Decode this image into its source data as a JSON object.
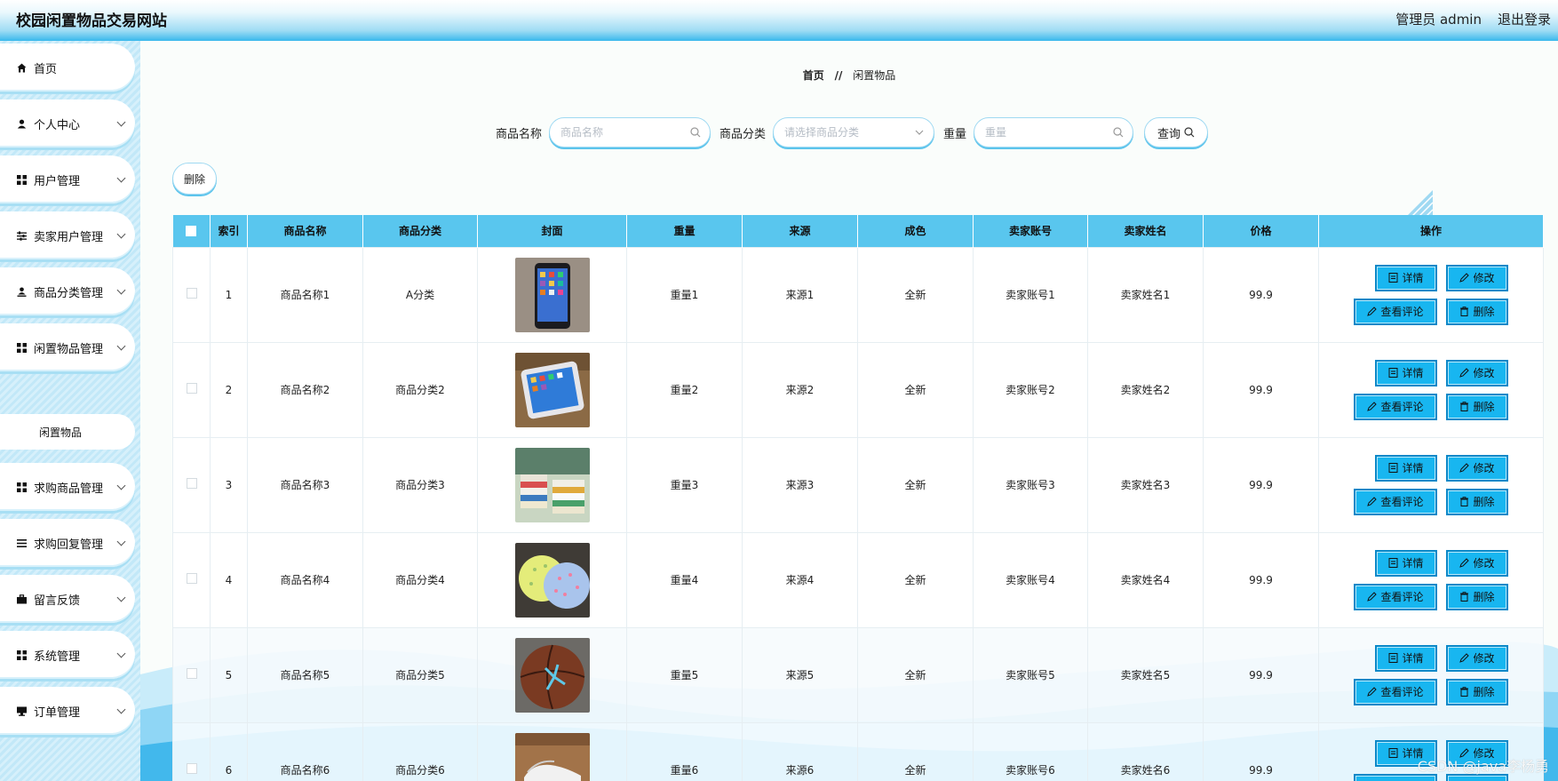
{
  "header": {
    "title": "校园闲置物品交易网站",
    "user_label": "管理员 admin",
    "logout_label": "退出登录"
  },
  "sidebar": {
    "items": [
      {
        "label": "首页",
        "icon": "home-icon",
        "expandable": false
      },
      {
        "label": "个人中心",
        "icon": "person-icon",
        "expandable": true
      },
      {
        "label": "用户管理",
        "icon": "grid-icon",
        "expandable": true
      },
      {
        "label": "卖家用户管理",
        "icon": "sliders-icon",
        "expandable": true
      },
      {
        "label": "商品分类管理",
        "icon": "user-upload-icon",
        "expandable": true
      },
      {
        "label": "闲置物品管理",
        "icon": "grid-icon",
        "expandable": true
      },
      {
        "label": "求购商品管理",
        "icon": "grid-icon",
        "expandable": true
      },
      {
        "label": "求购回复管理",
        "icon": "list-icon",
        "expandable": true
      },
      {
        "label": "留言反馈",
        "icon": "briefcase-icon",
        "expandable": true
      },
      {
        "label": "系统管理",
        "icon": "grid-icon",
        "expandable": true
      },
      {
        "label": "订单管理",
        "icon": "monitor-icon",
        "expandable": true
      }
    ],
    "submenu": {
      "label": "闲置物品"
    }
  },
  "breadcrumb": {
    "home": "首页",
    "separator": "//",
    "current": "闲置物品"
  },
  "search": {
    "name_label": "商品名称",
    "name_placeholder": "商品名称",
    "category_label": "商品分类",
    "category_placeholder": "请选择商品分类",
    "weight_label": "重量",
    "weight_placeholder": "重量",
    "query_label": "查询"
  },
  "toolbar": {
    "delete_label": "删除"
  },
  "table": {
    "headers": [
      "索引",
      "商品名称",
      "商品分类",
      "封面",
      "重量",
      "来源",
      "成色",
      "卖家账号",
      "卖家姓名",
      "价格",
      "操作"
    ],
    "rows": [
      {
        "index": "1",
        "name": "商品名称1",
        "category": "A分类",
        "cover": "smartphone-photo",
        "weight": "重量1",
        "source": "来源1",
        "condition": "全新",
        "seller_account": "卖家账号1",
        "seller_name": "卖家姓名1",
        "price": "99.9"
      },
      {
        "index": "2",
        "name": "商品名称2",
        "category": "商品分类2",
        "cover": "phone-on-table-photo",
        "weight": "重量2",
        "source": "来源2",
        "condition": "全新",
        "seller_account": "卖家账号2",
        "seller_name": "卖家姓名2",
        "price": "99.9"
      },
      {
        "index": "3",
        "name": "商品名称3",
        "category": "商品分类3",
        "cover": "book-stack-photo",
        "weight": "重量3",
        "source": "来源3",
        "condition": "全新",
        "seller_account": "卖家账号3",
        "seller_name": "卖家姓名3",
        "price": "99.9"
      },
      {
        "index": "4",
        "name": "商品名称4",
        "category": "商品分类4",
        "cover": "umbrellas-photo",
        "weight": "重量4",
        "source": "来源4",
        "condition": "全新",
        "seller_account": "卖家账号4",
        "seller_name": "卖家姓名4",
        "price": "99.9"
      },
      {
        "index": "5",
        "name": "商品名称5",
        "category": "商品分类5",
        "cover": "basketball-photo",
        "weight": "重量5",
        "source": "来源5",
        "condition": "全新",
        "seller_account": "卖家账号5",
        "seller_name": "卖家姓名5",
        "price": "99.9"
      },
      {
        "index": "6",
        "name": "商品名称6",
        "category": "商品分类6",
        "cover": "sneakers-photo",
        "weight": "重量6",
        "source": "来源6",
        "condition": "全新",
        "seller_account": "卖家账号6",
        "seller_name": "卖家姓名6",
        "price": "99.9"
      }
    ],
    "actions": {
      "detail": "详情",
      "edit": "修改",
      "comments": "查看评论",
      "delete": "删除"
    }
  },
  "watermark": "CSDN @java李杨勇",
  "colors": {
    "accent": "#18b6f0",
    "header_bar": "#59c6ee",
    "button_border": "#0a88c8"
  }
}
